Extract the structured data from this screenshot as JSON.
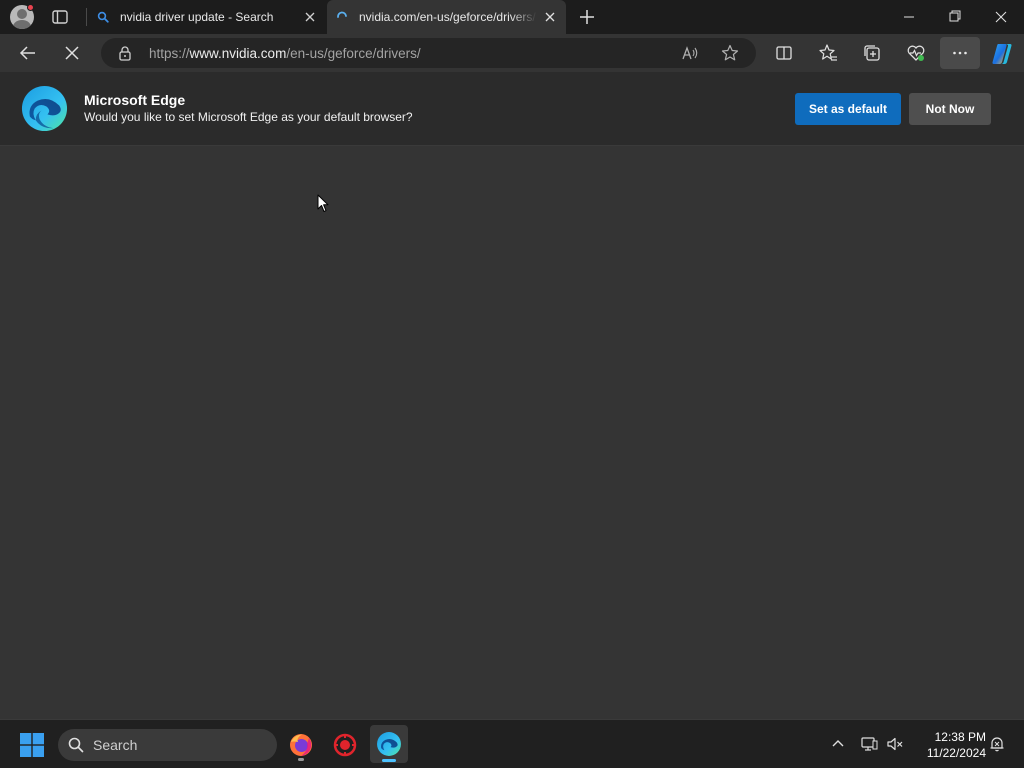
{
  "tabs": [
    {
      "title": "nvidia driver update - Search",
      "favicon": "search-icon",
      "active": false
    },
    {
      "title": "nvidia.com/en-us/geforce/drivers/",
      "favicon": "loading-spinner-icon",
      "active": true
    }
  ],
  "address": {
    "scheme": "https://",
    "host": "www.nvidia.com",
    "path": "/en-us/geforce/drivers/"
  },
  "infobar": {
    "title": "Microsoft Edge",
    "message": "Would you like to set Microsoft Edge as your default browser?",
    "primary_label": "Set as default",
    "secondary_label": "Not Now"
  },
  "taskbar": {
    "search_label": "Search",
    "time": "12:38 PM",
    "date": "11/22/2024"
  },
  "colors": {
    "accent": "#0f6cbd",
    "page_bg": "#343434",
    "tabstrip_bg": "#1c1c1c",
    "taskbar_bg": "#202020"
  }
}
